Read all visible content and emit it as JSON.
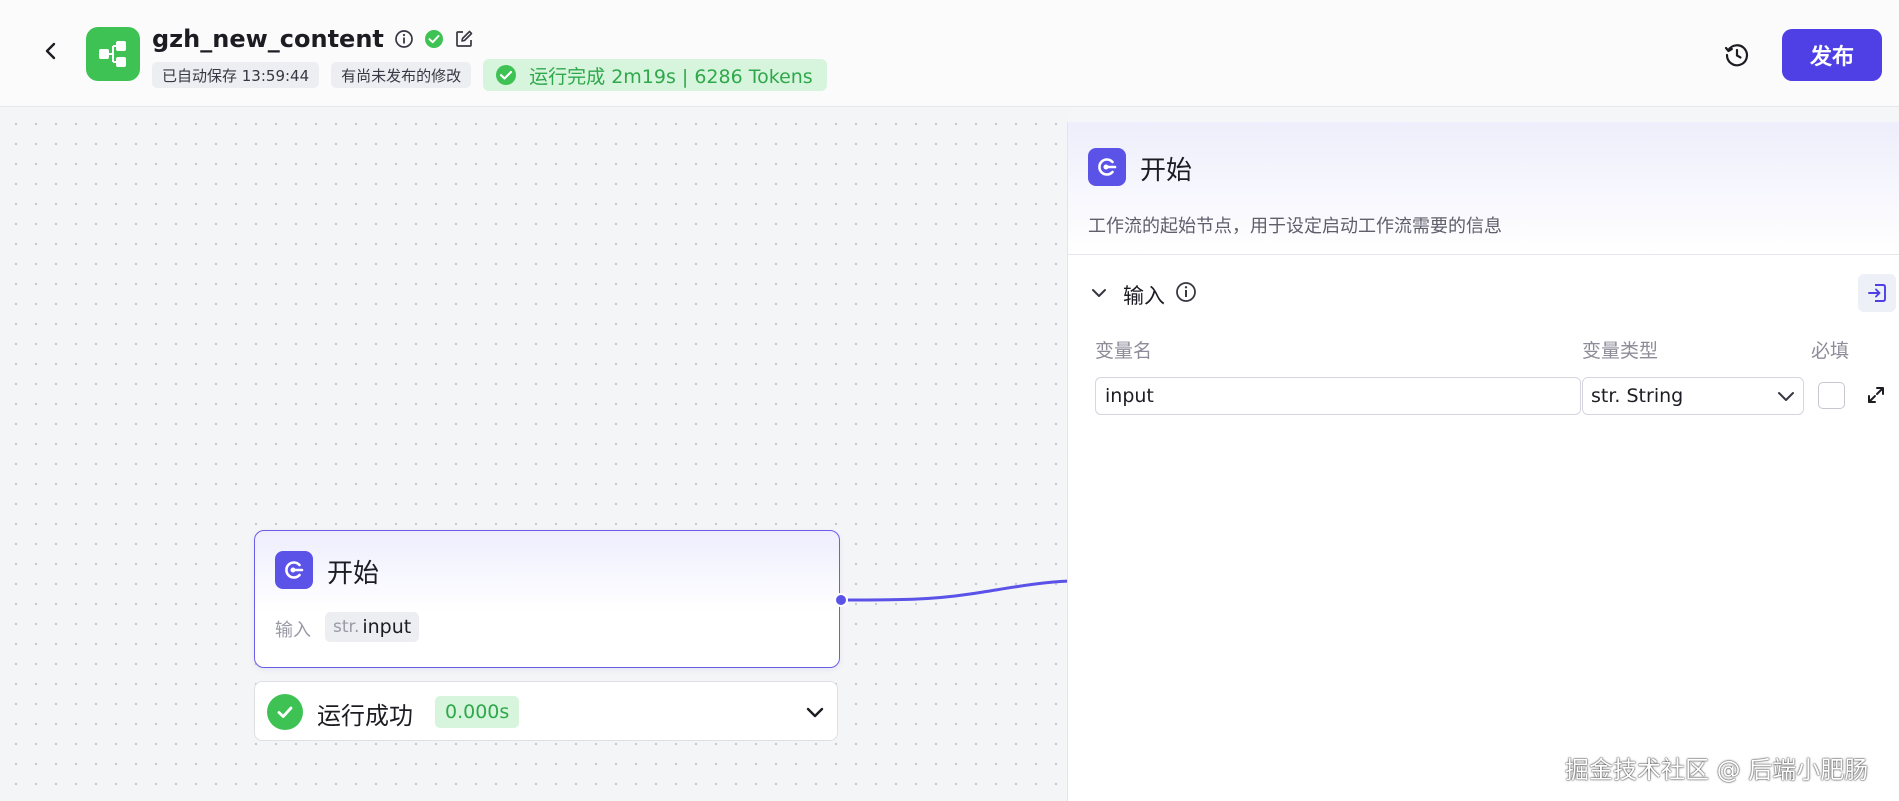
{
  "header": {
    "app_name": "gzh_new_content",
    "autosave": "已自动保存 13:59:44",
    "unpublished": "有尚未发布的修改",
    "run_status": "运行完成 2m19s | 6286 Tokens",
    "publish_label": "发布"
  },
  "canvas": {
    "start_node": {
      "title": "开始",
      "input_label": "输入",
      "var_prefix": "str.",
      "var_name": "input"
    },
    "result": {
      "status": "运行成功",
      "duration": "0.000s"
    }
  },
  "panel": {
    "title": "开始",
    "description": "工作流的起始节点，用于设定启动工作流需要的信息",
    "section_title": "输入",
    "columns": {
      "name": "变量名",
      "type": "变量类型",
      "required": "必填"
    },
    "row": {
      "name": "input",
      "type": "str. String"
    }
  },
  "watermark": "掘金技术社区 @ 后端小肥肠",
  "colors": {
    "accent": "#4e40e5",
    "success": "#3ec254",
    "node_border": "#6a5de8"
  }
}
